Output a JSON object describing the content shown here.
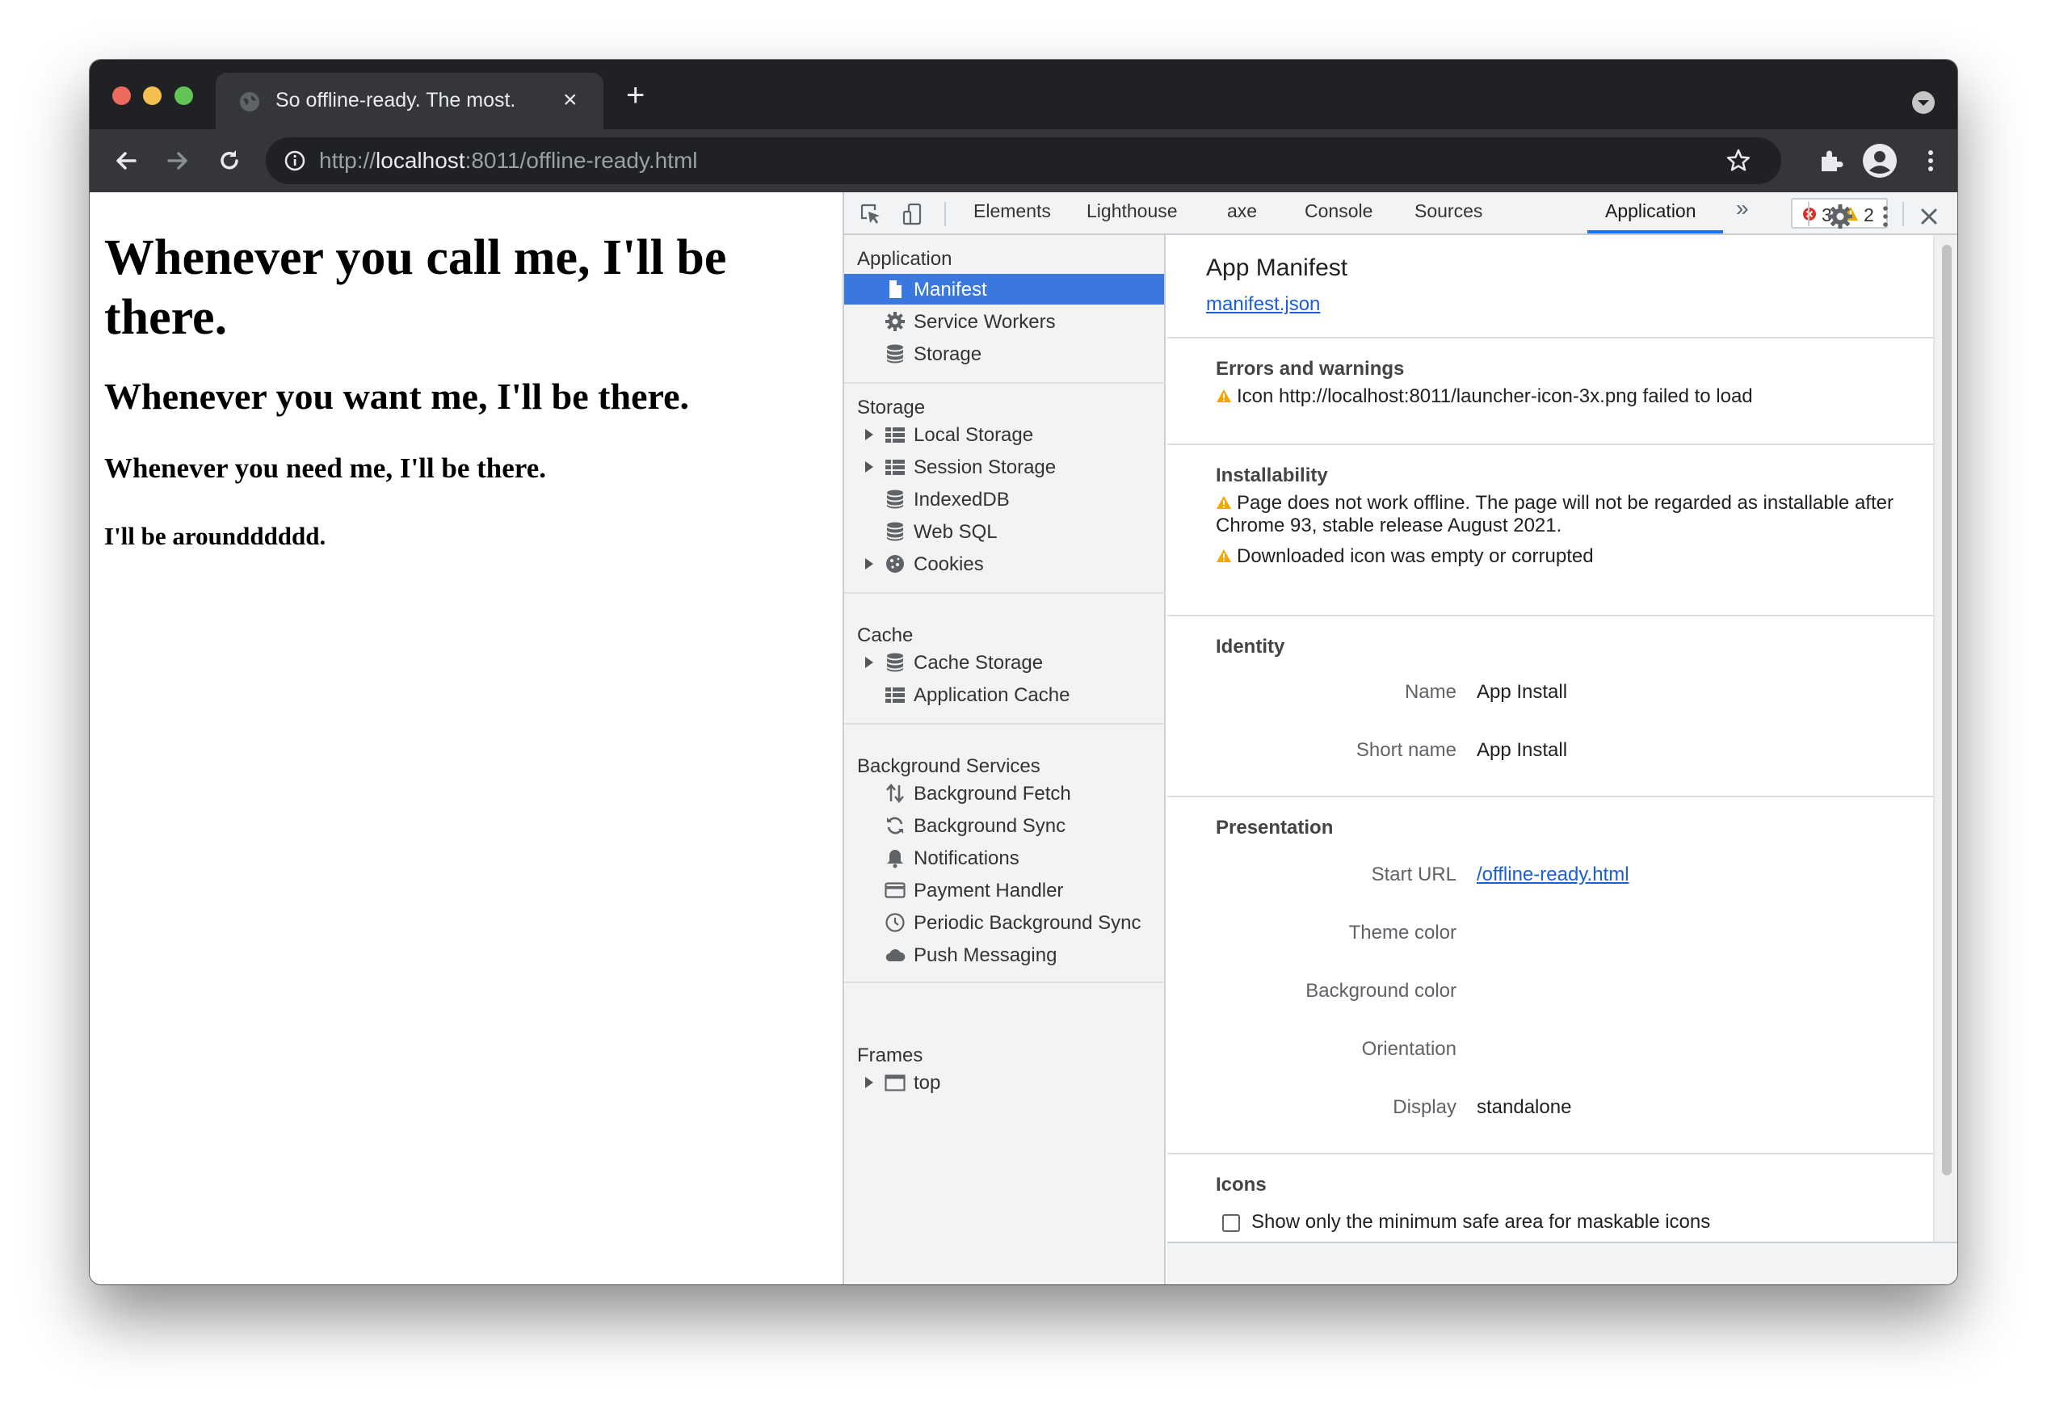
{
  "browser": {
    "tab_title": "So offline-ready. The most.",
    "tab_close": "×",
    "new_tab": "+",
    "url_scheme": "http://",
    "url_host": "localhost",
    "url_rest": ":8011/offline-ready.html"
  },
  "page": {
    "h1": "Whenever you call me, I'll be there.",
    "h2": "Whenever you want me, I'll be there.",
    "h3": "Whenever you need me, I'll be there.",
    "h4": "I'll be aroundddddd."
  },
  "devtools": {
    "tabs": [
      "Elements",
      "Lighthouse",
      "axe",
      "Console",
      "Sources",
      "Application"
    ],
    "more_tabs": "»",
    "errors_count": "3",
    "warnings_count": "2",
    "close": "✕",
    "sidebar": {
      "application": {
        "title": "Application",
        "items": [
          "Manifest",
          "Service Workers",
          "Storage"
        ]
      },
      "storage": {
        "title": "Storage",
        "items": [
          "Local Storage",
          "Session Storage",
          "IndexedDB",
          "Web SQL",
          "Cookies"
        ]
      },
      "cache": {
        "title": "Cache",
        "items": [
          "Cache Storage",
          "Application Cache"
        ]
      },
      "background": {
        "title": "Background Services",
        "items": [
          "Background Fetch",
          "Background Sync",
          "Notifications",
          "Payment Handler",
          "Periodic Background Sync",
          "Push Messaging"
        ]
      },
      "frames": {
        "title": "Frames",
        "items": [
          "top"
        ]
      }
    },
    "manifest": {
      "title": "App Manifest",
      "link": "manifest.json",
      "errors_title": "Errors and warnings",
      "errors": [
        "Icon http://localhost:8011/launcher-icon-3x.png failed to load"
      ],
      "installability_title": "Installability",
      "installability": [
        "Page does not work offline. The page will not be regarded as installable after Chrome 93, stable release August 2021.",
        "Downloaded icon was empty or corrupted"
      ],
      "identity_title": "Identity",
      "name_label": "Name",
      "name_value": "App Install",
      "short_name_label": "Short name",
      "short_name_value": "App Install",
      "presentation_title": "Presentation",
      "start_url_label": "Start URL",
      "start_url_value": "/offline-ready.html",
      "theme_color_label": "Theme color",
      "background_color_label": "Background color",
      "orientation_label": "Orientation",
      "display_label": "Display",
      "display_value": "standalone",
      "icons_title": "Icons",
      "maskable_checkbox_label": "Show only the minimum safe area for maskable icons"
    }
  },
  "colors": {
    "selected": "#3a78e0",
    "link": "#1a5fd6",
    "warning": "#f2a600",
    "error": "#d93025"
  }
}
